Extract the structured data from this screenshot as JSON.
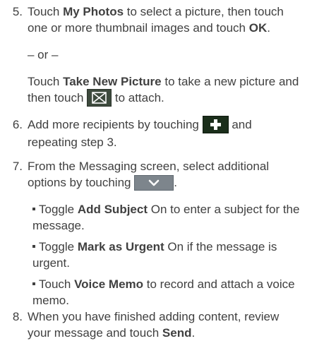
{
  "steps": {
    "s5": {
      "number": "5.",
      "line1a": "Touch ",
      "my_photos": "My Photos",
      "line1b": " to select a picture, then touch",
      "line2a": "one or more thumbnail images and touch ",
      "ok": "OK",
      "line2b": ".",
      "or": "– or –",
      "line3a": "Touch ",
      "take_new_picture": "Take New Picture",
      "line3b": " to take a new picture and",
      "line4a": "then touch ",
      "line4b": " to attach."
    },
    "s6": {
      "number": "6.",
      "line1a": "Add more recipients by touching ",
      "line1b": " and",
      "line2": "repeating step 3."
    },
    "s7": {
      "number": "7.",
      "line1": "From the Messaging screen, select additional",
      "line2a": "options by touching ",
      "line2b": ".",
      "bullets": [
        {
          "pre": "Toggle ",
          "bold": "Add Subject",
          "post_line1": " On to enter a subject for the",
          "line2": "message."
        },
        {
          "pre": "Toggle ",
          "bold": "Mark as Urgent",
          "post_line1": " On if the message is",
          "line2": "urgent."
        },
        {
          "pre": "Touch ",
          "bold": "Voice Memo",
          "post_line1": " to record and attach a voice",
          "line2": "memo."
        }
      ]
    },
    "s8": {
      "number": "8.",
      "line1": "When you have finished adding content, review",
      "line2a": "your message and touch ",
      "send": "Send",
      "line2b": "."
    }
  },
  "icons": {
    "attach": "envelope-icon",
    "add": "plus-icon",
    "menu": "chevron-down-icon"
  }
}
